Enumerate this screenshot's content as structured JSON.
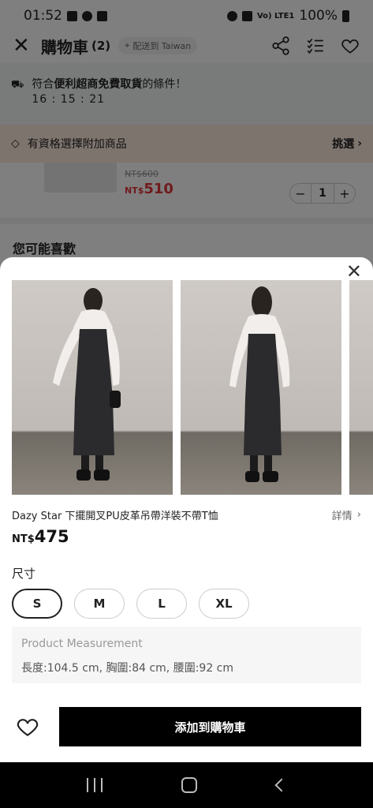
{
  "status_bar": {
    "time": "01:52",
    "battery": "100%",
    "network": "Vo) LTE1"
  },
  "cart_header": {
    "title": "購物車",
    "count": "(2)",
    "ship_to": "配送到 Taiwan"
  },
  "promo": {
    "prefix": "符合",
    "highlight": "便利超商免費取貨",
    "suffix": "的條件！",
    "timer": "16 : 15 : 21"
  },
  "addon": {
    "label": "有資格選擇附加商品",
    "pick": "挑選"
  },
  "cart_item": {
    "old_price": "NT$600",
    "currency": "NT$",
    "new_price": "510",
    "quantity": "1",
    "minus": "−",
    "plus": "+"
  },
  "you_may_like": "您可能喜歡",
  "sheet": {
    "close": "✕",
    "product_name": "Dazy Star 下擺開叉PU皮革吊帶洋裝不帶T恤",
    "details": "詳情",
    "price_currency": "NT$",
    "price_value": "475",
    "size_label": "尺寸",
    "sizes": [
      {
        "label": "S",
        "selected": true
      },
      {
        "label": "M",
        "selected": false
      },
      {
        "label": "L",
        "selected": false
      },
      {
        "label": "XL",
        "selected": false
      }
    ],
    "measurement_title": "Product Measurement",
    "measurement_text": "長度:104.5 cm, 胸圍:84 cm, 腰圍:92 cm",
    "add_to_cart": "添加到購物車"
  },
  "colors": {
    "accent_price": "#e3343a",
    "addon_bg": "#fde8dc",
    "promo_bg": "#f3f7f6",
    "button_black": "#000000"
  }
}
